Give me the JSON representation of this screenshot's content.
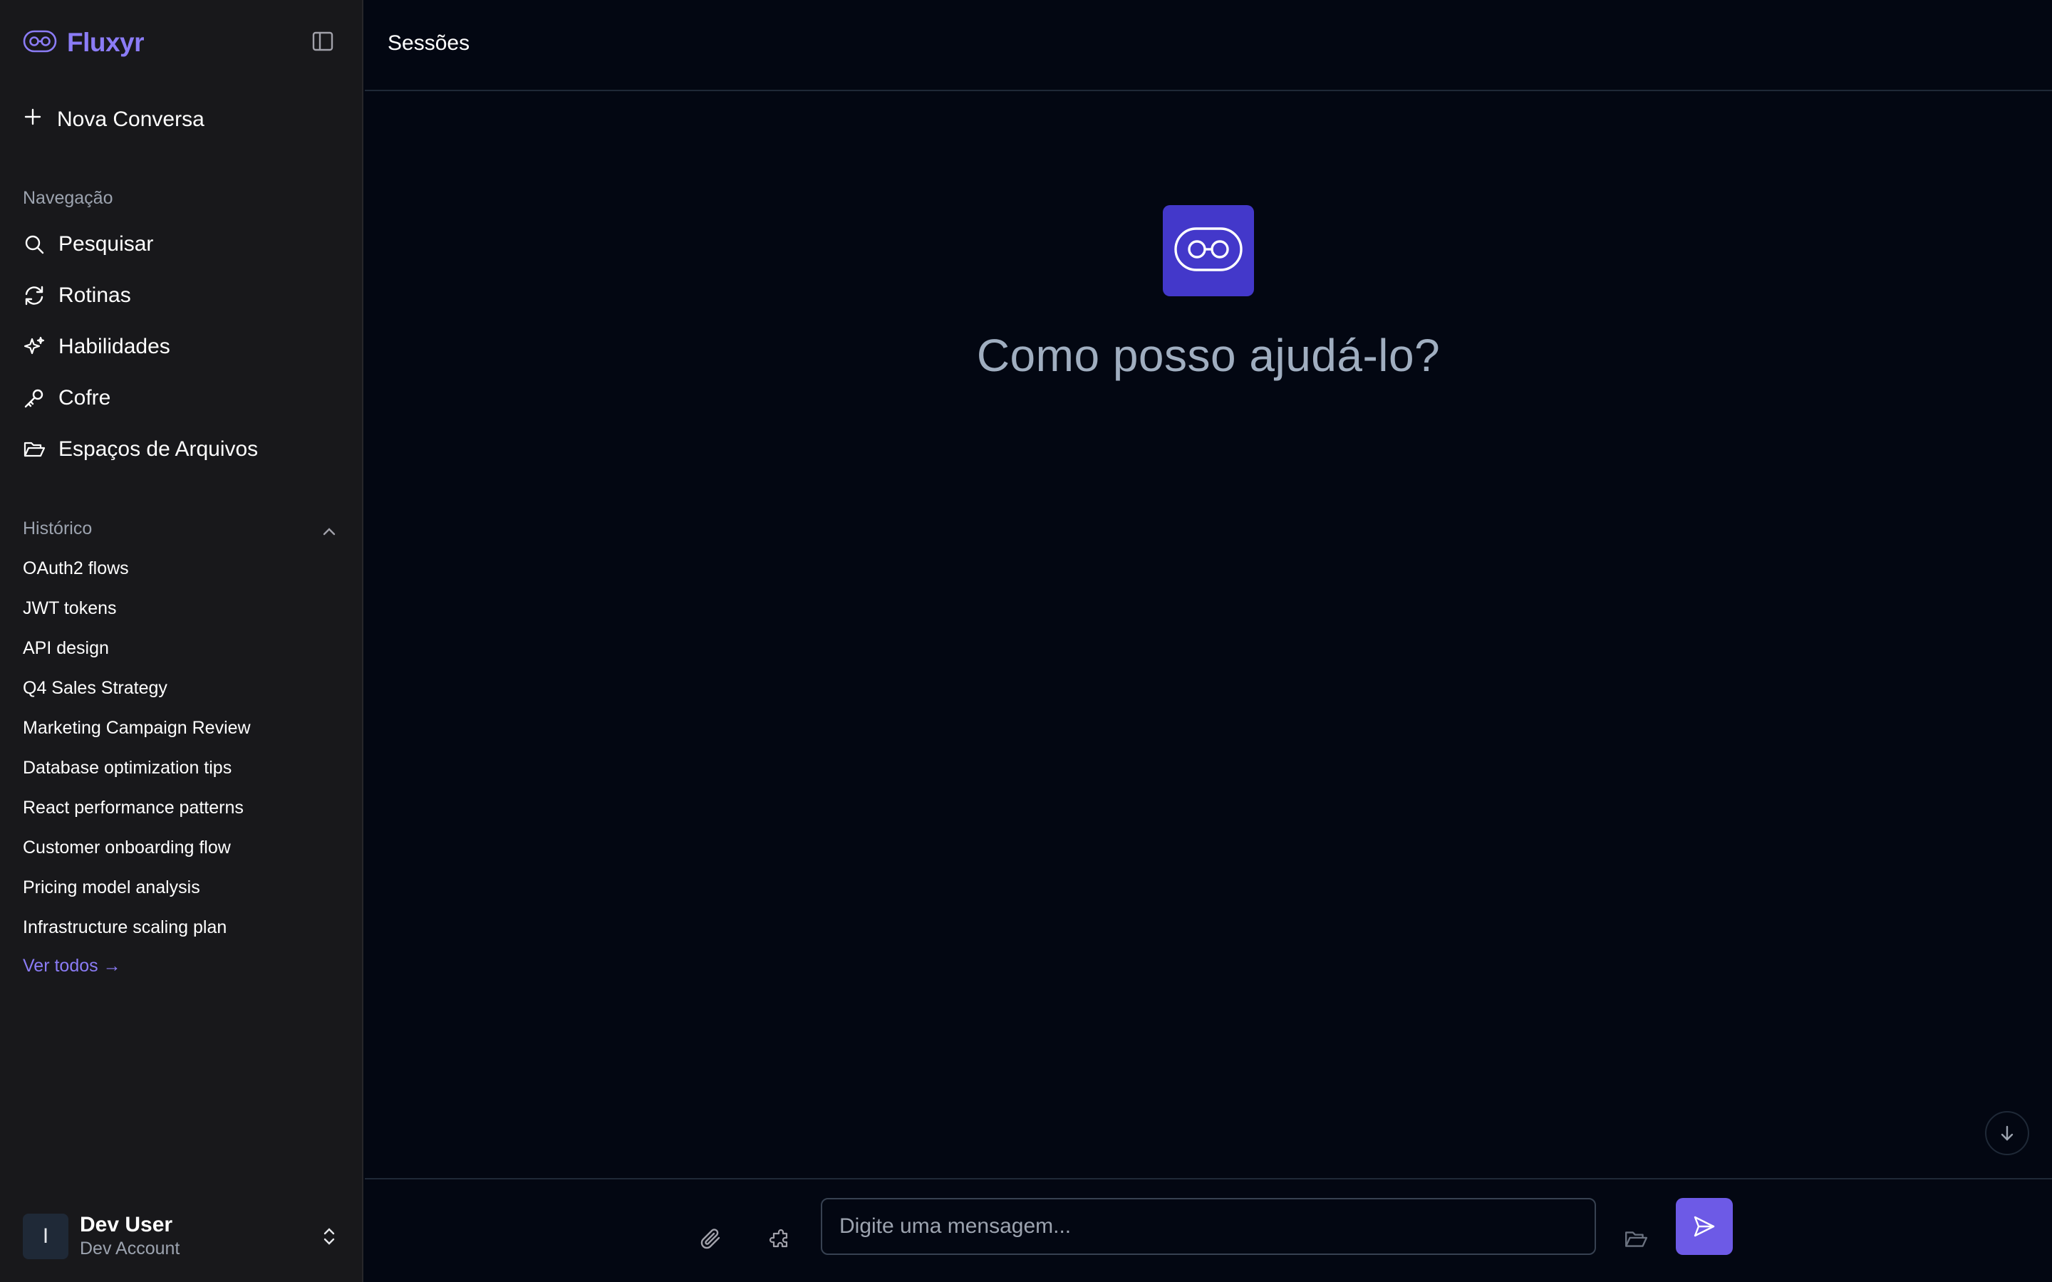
{
  "brand": {
    "name": "Fluxyr",
    "accent": "#8b7cf6"
  },
  "sidebar": {
    "new_chat_label": "Nova Conversa",
    "navigation_heading": "Navegação",
    "nav_items": [
      {
        "label": "Pesquisar",
        "icon": "search-icon"
      },
      {
        "label": "Rotinas",
        "icon": "refresh-icon"
      },
      {
        "label": "Habilidades",
        "icon": "sparkles-icon"
      },
      {
        "label": "Cofre",
        "icon": "key-icon"
      },
      {
        "label": "Espaços de Arquivos",
        "icon": "folder-open-icon"
      }
    ],
    "history_heading": "Histórico",
    "history_items": [
      "OAuth2 flows",
      "JWT tokens",
      "API design",
      "Q4 Sales Strategy",
      "Marketing Campaign Review",
      "Database optimization tips",
      "React performance patterns",
      "Customer onboarding flow",
      "Pricing model analysis",
      "Infrastructure scaling plan"
    ],
    "see_all_label": "Ver todos →"
  },
  "user": {
    "initial": "I",
    "name": "Dev User",
    "account": "Dev Account"
  },
  "header": {
    "title": "Sessões"
  },
  "main": {
    "greeting": "Como posso ajudá-lo?"
  },
  "composer": {
    "placeholder": "Digite uma mensagem...",
    "value": ""
  },
  "colors": {
    "sidebar_bg": "#18181b",
    "main_bg": "#030712",
    "accent": "#8b7cf6",
    "send_button": "#6d5ae6",
    "hero_icon_bg": "#4338ca"
  }
}
